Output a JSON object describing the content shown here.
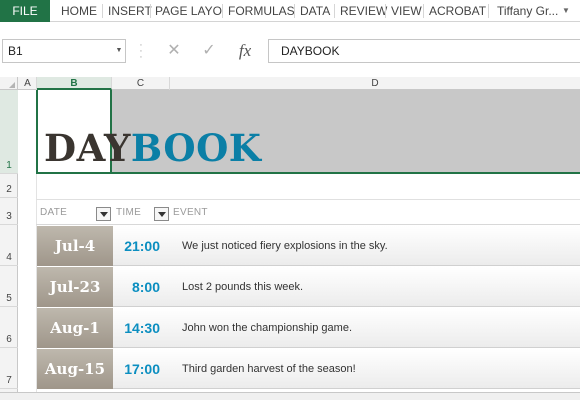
{
  "ribbon": {
    "file_label": "FILE",
    "tabs": [
      "HOME",
      "INSERT",
      "PAGE LAYO",
      "FORMULAS",
      "DATA",
      "REVIEW",
      "VIEW",
      "ACROBAT"
    ],
    "user": "Tiffany Gr..."
  },
  "formula_bar": {
    "name_box": "B1",
    "cancel_icon": "✕",
    "enter_icon": "✓",
    "fx_label": "fx",
    "formula": "DAYBOOK"
  },
  "columns": [
    "A",
    "B",
    "C",
    "D"
  ],
  "rows": [
    "1",
    "2",
    "3",
    "4",
    "5",
    "6",
    "7"
  ],
  "title": {
    "part1": "DAY",
    "part2": "BOOK"
  },
  "table": {
    "headers": {
      "date": "DATE",
      "time": "TIME",
      "event": "EVENT"
    },
    "entries": [
      {
        "date": "Jul-4",
        "time": "21:00",
        "event": "We just noticed fiery explosions in the sky."
      },
      {
        "date": "Jul-23",
        "time": "8:00",
        "event": "Lost 2 pounds this week."
      },
      {
        "date": "Aug-1",
        "time": "14:30",
        "event": "John won the championship game."
      },
      {
        "date": "Aug-15",
        "time": "17:00",
        "event": "Third garden harvest of the season!"
      }
    ]
  },
  "colors": {
    "excel_green": "#217346",
    "title_dark": "#3a3530",
    "title_blue": "#0b7fa6",
    "time_blue": "#0b8ec0",
    "date_taupe": "#a89f93"
  }
}
